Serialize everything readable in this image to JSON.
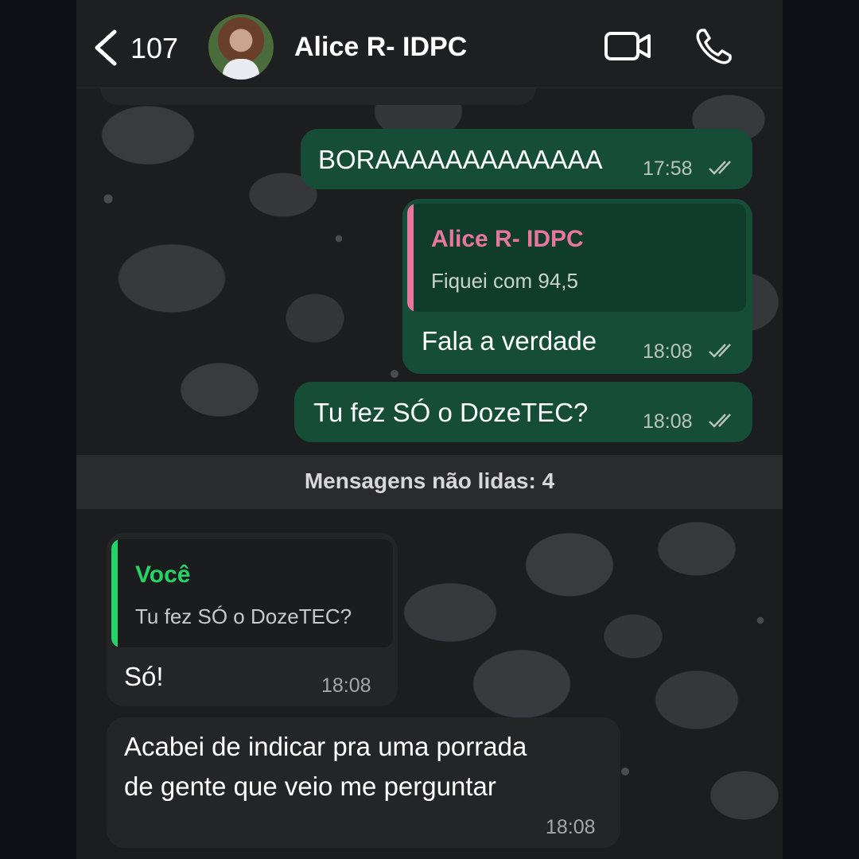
{
  "header": {
    "back_count": "107",
    "contact_name": "Alice R- IDPC"
  },
  "messages": [
    {
      "text": "BORAAAAAAAAAAAAA",
      "time": "17:58"
    },
    {
      "quote_name": "Alice R- IDPC",
      "quote_text": "Fiquei com 94,5",
      "text": "Fala a verdade",
      "time": "18:08"
    },
    {
      "text": "Tu fez SÓ o DozeTEC?",
      "time": "18:08"
    }
  ],
  "unread_banner": "Mensagens não lidas: 4",
  "incoming": [
    {
      "quote_name": "Você",
      "quote_text": "Tu fez SÓ o DozeTEC?",
      "text": "Só!",
      "time": "18:08"
    },
    {
      "line1": "Acabei de indicar pra uma porrada",
      "line2": "de gente que veio me perguntar",
      "time": "18:08"
    }
  ],
  "colors": {
    "outgoing_bubble": "#154d36",
    "incoming_bubble": "#242526",
    "quote_pink": "#e8769f",
    "quote_green": "#25d366"
  }
}
